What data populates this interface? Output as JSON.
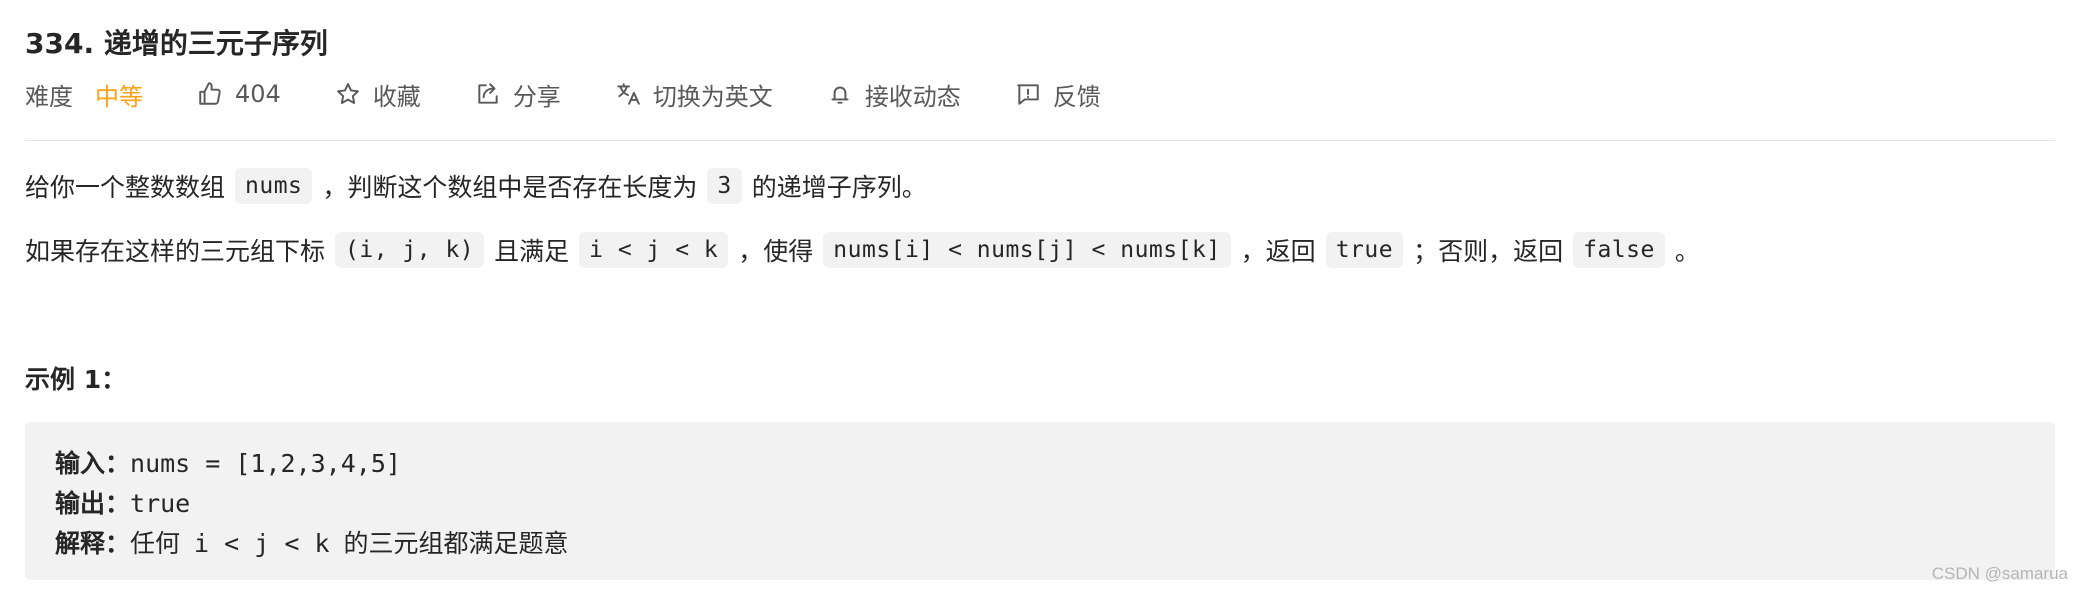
{
  "problem": {
    "title": "334. 递增的三元子序列"
  },
  "meta": {
    "difficulty_label": "难度",
    "difficulty_value": "中等",
    "difficulty_color": "#ffa116",
    "likes_count": "404",
    "collect_label": "收藏",
    "share_label": "分享",
    "switch_lang_label": "切换为英文",
    "subscribe_label": "接收动态",
    "feedback_label": "反馈",
    "icons": {
      "like": "thumbs-up-icon",
      "collect": "star-icon",
      "share": "share-icon",
      "translate": "translate-icon",
      "subscribe": "bell-icon",
      "feedback": "feedback-icon"
    }
  },
  "description": {
    "p1": {
      "t1": "给你一个整数数组",
      "c1": "nums",
      "t2": "，判断这个数组中是否存在长度为",
      "c2": "3",
      "t3": "的递增子序列。"
    },
    "p2": {
      "t1": "如果存在这样的三元组下标",
      "c1": "(i, j, k)",
      "t2": "且满足",
      "c2": "i < j < k",
      "t3": "，使得",
      "c3": "nums[i] < nums[j] < nums[k]",
      "t4": "，返回",
      "c4": "true",
      "t5": "；否则，返回",
      "c5": "false",
      "t6": "。"
    }
  },
  "example": {
    "title": "示例 1：",
    "input_label": "输入：",
    "input_value": "nums = [1,2,3,4,5]",
    "output_label": "输出：",
    "output_value": "true",
    "explain_label": "解释：",
    "explain_t1": "任何",
    "explain_code": "i < j < k",
    "explain_t2": "的三元组都满足题意"
  },
  "watermark": "CSDN @samarua"
}
